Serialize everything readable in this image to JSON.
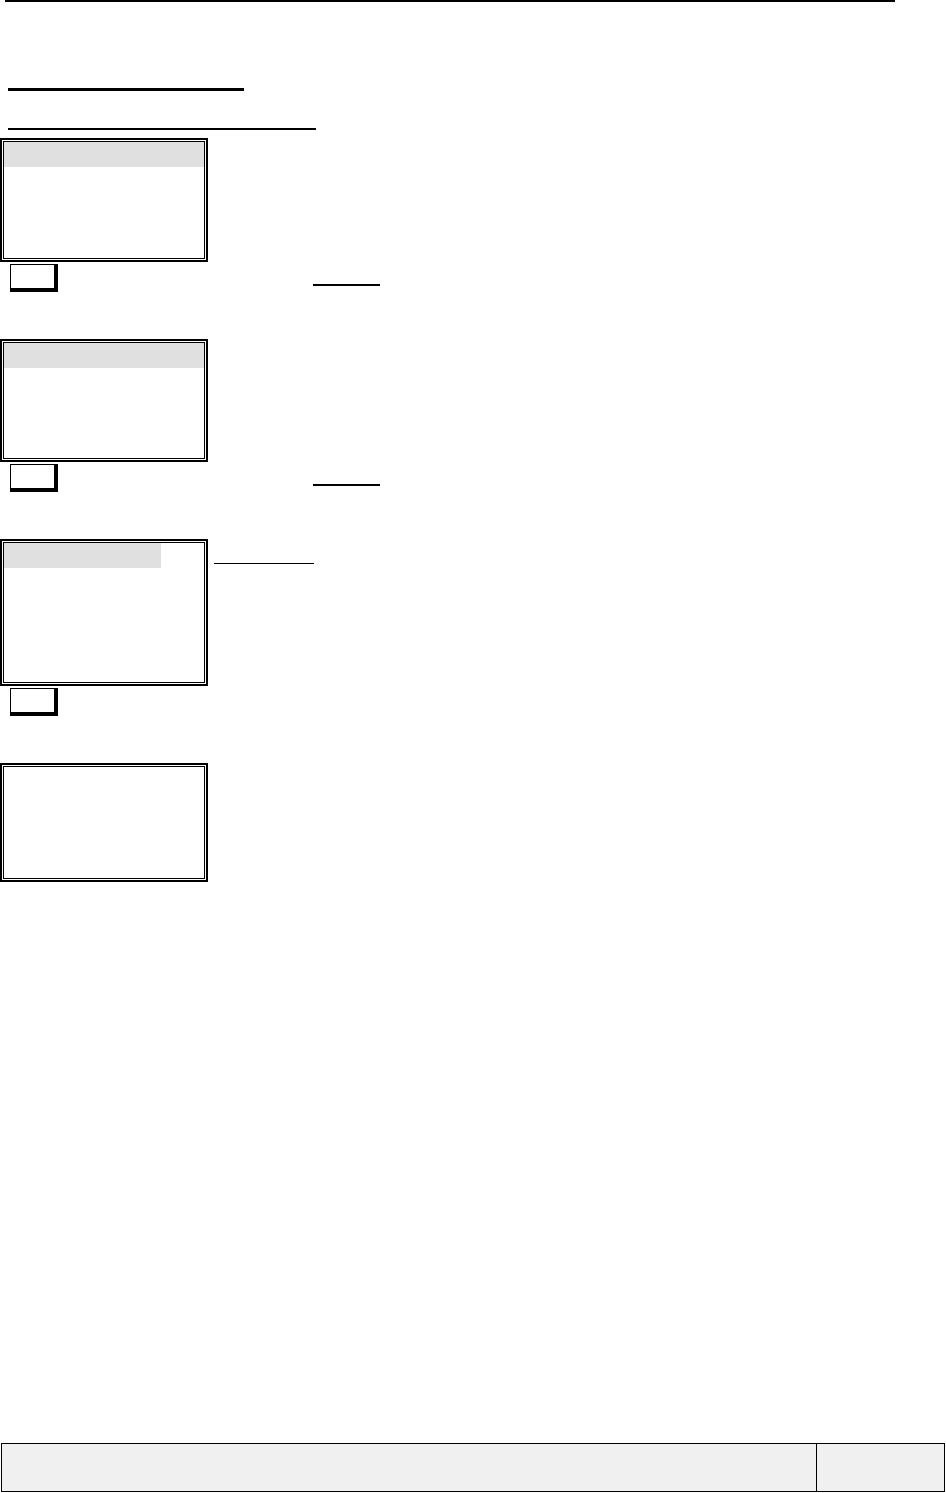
{
  "headings": [
    {
      "kind": "title"
    },
    {
      "kind": "subtitle"
    }
  ],
  "screens": [
    {
      "kind": "list",
      "highlighted": true,
      "key": true,
      "underlined": true
    },
    {
      "kind": "list",
      "highlighted": true,
      "key": true,
      "underlined": true
    },
    {
      "kind": "menu",
      "highlighted": true,
      "key": true,
      "underlined": true
    },
    {
      "kind": "list",
      "highlighted": false,
      "key": false,
      "underlined": false
    }
  ],
  "footer": {
    "cells": [
      {
        "kind": "wide"
      },
      {
        "kind": "narrow"
      }
    ]
  }
}
